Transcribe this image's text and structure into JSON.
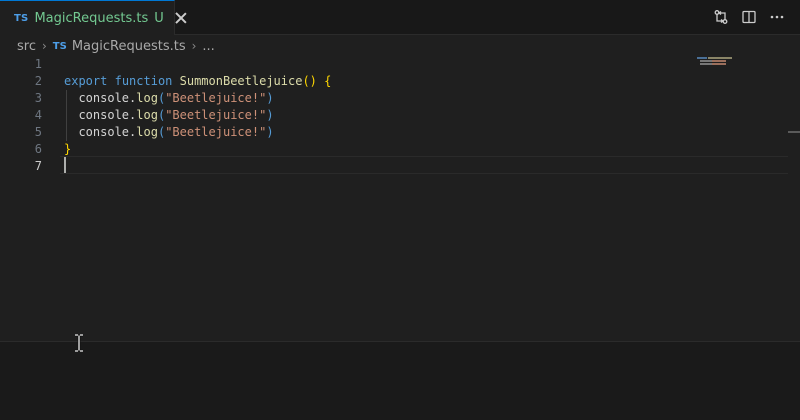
{
  "tab": {
    "badge": "TS",
    "filename": "MagicRequests.ts",
    "status": "U"
  },
  "toolbar": {
    "icons": [
      "compare-changes-icon",
      "split-editor-icon",
      "more-actions-icon"
    ]
  },
  "breadcrumb": {
    "folder": "src",
    "badge": "TS",
    "file": "MagicRequests.ts",
    "more": "..."
  },
  "editor": {
    "active_line": 7,
    "line_numbers": [
      "1",
      "2",
      "3",
      "4",
      "5",
      "6",
      "7"
    ],
    "code": {
      "l2_kw1": "export",
      "l2_kw2": "function",
      "l2_fn": "SummonBeetlejuice",
      "l2_paren": "()",
      "l2_brace": "{",
      "log_obj": "console",
      "log_dot": ".",
      "log_method": "log",
      "log_open": "(",
      "log_arg": "\"Beetlejuice!\"",
      "log_close": ")",
      "l6_brace": "}"
    }
  },
  "colors": {
    "accent": "#0078d4",
    "modified_green": "#73c991",
    "ts_blue": "#4d9ee8"
  }
}
